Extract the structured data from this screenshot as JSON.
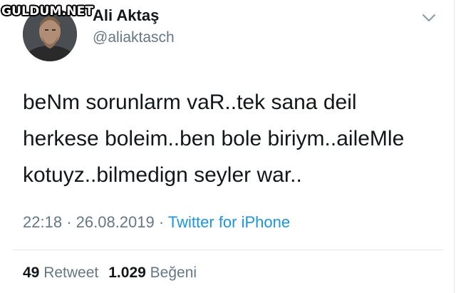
{
  "watermark": "GULDUM.NET",
  "author": {
    "display_name": "Ali Aktaş",
    "handle": "@aliaktasch"
  },
  "tweet": {
    "lines": [
      "beNm sorunlarm vaR..tek sana deil",
      "herkese boleim..ben bole biriym..aileMle",
      "kotuyz..bilmedign seyler war.."
    ],
    "time": "22:18",
    "date": "26.08.2019",
    "separator": "·",
    "source": "Twitter for iPhone"
  },
  "stats": {
    "retweets_count": "49",
    "retweets_label": "Retweet",
    "likes_count": "1.029",
    "likes_label": "Beğeni"
  },
  "icons": {
    "menu": "chevron-down-icon"
  },
  "colors": {
    "text": "#14171a",
    "secondary": "#657786",
    "link": "#1b95e0",
    "divider": "#e1e8ed"
  }
}
